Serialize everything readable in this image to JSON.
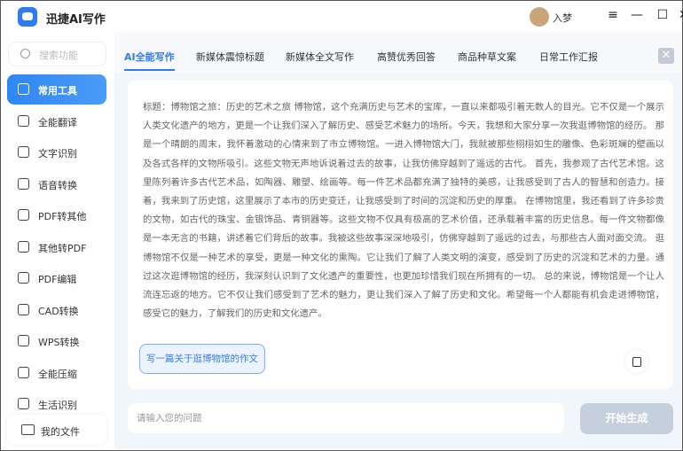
{
  "app": {
    "title": "迅捷AI写作",
    "user": "入梦"
  },
  "search": {
    "placeholder": "搜索功能"
  },
  "sidebar": {
    "items": [
      {
        "label": "常用工具",
        "icon": "toolbox-icon",
        "active": true
      },
      {
        "label": "全能翻译",
        "icon": "translate-icon"
      },
      {
        "label": "文字识别",
        "icon": "text-scan-icon"
      },
      {
        "label": "语音转换",
        "icon": "voice-icon"
      },
      {
        "label": "PDF转其他",
        "icon": "pdf-icon"
      },
      {
        "label": "其他转PDF",
        "icon": "to-pdf-icon"
      },
      {
        "label": "PDF编辑",
        "icon": "pdf-edit-icon"
      },
      {
        "label": "CAD转换",
        "icon": "cad-icon"
      },
      {
        "label": "WPS转换",
        "icon": "wps-icon"
      },
      {
        "label": "全能压缩",
        "icon": "compress-icon"
      },
      {
        "label": "生活识别",
        "icon": "scan-icon"
      }
    ],
    "my_files": "我的文件"
  },
  "tabs": [
    "AI全能写作",
    "新媒体震惊标题",
    "新媒体全文写作",
    "高赞优秀回答",
    "商品种草文案",
    "日常工作汇报"
  ],
  "essay": "标题：博物馆之旅：历史的艺术之旅 博物馆，这个充满历史与艺术的宝库，一直以来都吸引着无数人的目光。它不仅是一个展示人类文化遗产的地方，更是一个让我们深入了解历史、感受艺术魅力的场所。今天，我想和大家分享一次我逛博物馆的经历。 那是一个晴朗的周末，我怀着激动的心情来到了市立博物馆。一进入博物馆大门，我就被那些栩栩如生的雕像、色彩斑斓的壁画以及各式各样的文物所吸引。这些文物无声地诉说着过去的故事，让我仿佛穿越到了遥远的古代。 首先，我参观了古代艺术馆。这里陈列着许多古代艺术品，如陶器、雕塑、绘画等。每一件艺术品都充满了独特的美感，让我感受到了古人的智慧和创造力。接着，我来到了历史馆，这里展示了本市的历史变迁，让我感受到了时间的沉淀和历史的厚重。 在博物馆里，我还看到了许多珍贵的文物，如古代的珠宝、金银饰品、青铜器等。这些文物不仅具有极高的艺术价值，还承载着丰富的历史信息。每一件文物都像是一本无言的书籍，讲述着它们背后的故事。我被这些故事深深地吸引，仿佛穿越到了遥远的过去，与那些古人面对面交流。 逛博物馆不仅是一种艺术的享受，更是一种文化的熏陶。它让我们了解了人类文明的演变，感受到了历史的沉淀和艺术的力量。通过这次逛博物馆的经历，我深刻认识到了文化遗产的重要性，也更加珍惜我们现在所拥有的一切。 总的来说，博物馆是一个让人流连忘返的地方。它不仅让我们感受到了艺术的魅力，更让我们深入了解了历史和文化。希望每一个人都能有机会走进博物馆，感受它的魅力，了解我们的历史和文化遗产。",
  "prompt_chip": "写一篇关于逛博物馆的作文",
  "question": {
    "placeholder": "请输入您的问题",
    "value": ""
  },
  "generate_label": "开始生成",
  "colors": {
    "accent": "#2f7bf5",
    "disabled": "#c6d0dd",
    "background": "#f1f6fd"
  }
}
